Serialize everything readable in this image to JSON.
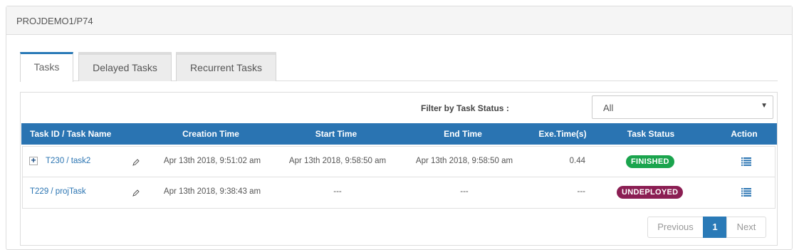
{
  "panel": {
    "title": "PROJDEMO1/P74"
  },
  "tabs": [
    {
      "label": "Tasks",
      "active": true
    },
    {
      "label": "Delayed Tasks",
      "active": false
    },
    {
      "label": "Recurrent Tasks",
      "active": false
    }
  ],
  "filter": {
    "label": "Filter by Task Status :",
    "selected": "All"
  },
  "table": {
    "headers": [
      "Task ID / Task Name",
      "Creation Time",
      "Start Time",
      "End Time",
      "Exe.Time(s)",
      "Task Status",
      "Action"
    ],
    "rows": [
      {
        "task": "T230 / task2",
        "expandable": true,
        "creation": "Apr 13th 2018, 9:51:02 am",
        "start": "Apr 13th 2018, 9:58:50 am",
        "end": "Apr 13th 2018, 9:58:50 am",
        "exe": "0.44",
        "status": "FINISHED",
        "status_color": "#1aa44d"
      },
      {
        "task": "T229 / projTask",
        "expandable": false,
        "creation": "Apr 13th 2018, 9:38:43 am",
        "start": "---",
        "end": "---",
        "exe": "---",
        "status": "UNDEPLOYED",
        "status_color": "#8b1e53"
      }
    ]
  },
  "pagination": {
    "previous": "Previous",
    "current": "1",
    "next": "Next"
  },
  "colors": {
    "accent": "#2a74b2",
    "header_bg": "#f5f5f5"
  },
  "icons": {
    "expand": "plus-icon",
    "edit": "pencil-icon",
    "action": "list-icon",
    "dropdown": "caret-down-icon"
  }
}
